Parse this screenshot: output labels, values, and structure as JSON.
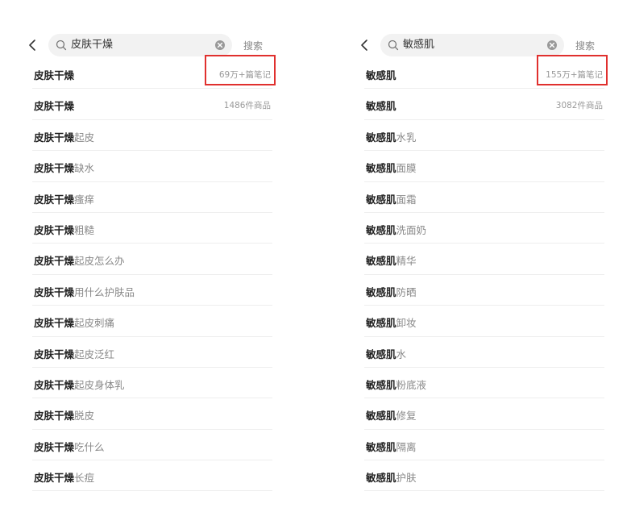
{
  "left": {
    "query": "皮肤干燥",
    "search_label": "搜索",
    "items": [
      {
        "bold": "皮肤干燥",
        "rest": "",
        "meta": "69万+篇笔记",
        "highlight": true
      },
      {
        "bold": "皮肤干燥",
        "rest": "",
        "meta": "1486件商品"
      },
      {
        "bold": "皮肤干燥",
        "rest": "起皮",
        "meta": ""
      },
      {
        "bold": "皮肤干燥",
        "rest": "缺水",
        "meta": ""
      },
      {
        "bold": "皮肤干燥",
        "rest": "瘙痒",
        "meta": ""
      },
      {
        "bold": "皮肤干燥",
        "rest": "粗糙",
        "meta": ""
      },
      {
        "bold": "皮肤干燥",
        "rest": "起皮怎么办",
        "meta": ""
      },
      {
        "bold": "皮肤干燥",
        "rest": "用什么护肤品",
        "meta": ""
      },
      {
        "bold": "皮肤干燥",
        "rest": "起皮刺痛",
        "meta": ""
      },
      {
        "bold": "皮肤干燥",
        "rest": "起皮泛红",
        "meta": ""
      },
      {
        "bold": "皮肤干燥",
        "rest": "起皮身体乳",
        "meta": ""
      },
      {
        "bold": "皮肤干燥",
        "rest": "脱皮",
        "meta": ""
      },
      {
        "bold": "皮肤干燥",
        "rest": "吃什么",
        "meta": ""
      },
      {
        "bold": "皮肤干燥",
        "rest": "长痘",
        "meta": ""
      }
    ]
  },
  "right": {
    "query": "敏感肌",
    "search_label": "搜索",
    "items": [
      {
        "bold": "敏感肌",
        "rest": "",
        "meta": "155万+篇笔记",
        "highlight": true
      },
      {
        "bold": "敏感肌",
        "rest": "",
        "meta": "3082件商品"
      },
      {
        "bold": "敏感肌",
        "rest": "水乳",
        "meta": ""
      },
      {
        "bold": "敏感肌",
        "rest": "面膜",
        "meta": ""
      },
      {
        "bold": "敏感肌",
        "rest": "面霜",
        "meta": ""
      },
      {
        "bold": "敏感肌",
        "rest": "洗面奶",
        "meta": ""
      },
      {
        "bold": "敏感肌",
        "rest": "精华",
        "meta": ""
      },
      {
        "bold": "敏感肌",
        "rest": "防晒",
        "meta": ""
      },
      {
        "bold": "敏感肌",
        "rest": "卸妆",
        "meta": ""
      },
      {
        "bold": "敏感肌",
        "rest": "水",
        "meta": ""
      },
      {
        "bold": "敏感肌",
        "rest": "粉底液",
        "meta": ""
      },
      {
        "bold": "敏感肌",
        "rest": "修复",
        "meta": ""
      },
      {
        "bold": "敏感肌",
        "rest": "隔离",
        "meta": ""
      },
      {
        "bold": "敏感肌",
        "rest": "护肤",
        "meta": ""
      }
    ]
  },
  "colors": {
    "highlight": "#e0302e",
    "search_bg": "#f2f2f2",
    "divider": "#eeeeee"
  },
  "icons": {
    "back": "chevron-left-icon",
    "search": "magnifier-icon",
    "clear": "clear-circle-icon"
  }
}
